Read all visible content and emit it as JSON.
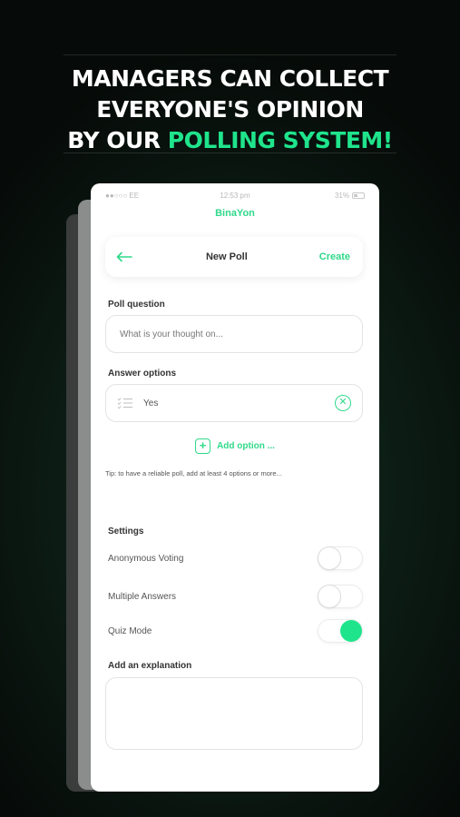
{
  "headline": {
    "line1": "MANAGERS CAN COLLECT",
    "line2": "EVERYONE'S OPINION",
    "line3_prefix": "BY OUR ",
    "line3_accent": "POLLING SYSTEM!"
  },
  "status_bar": {
    "carrier": "●●○○○ EE",
    "time": "12:53 pm",
    "battery": "31%"
  },
  "app": {
    "name": "BinaYon"
  },
  "navbar": {
    "title": "New Poll",
    "action": "Create"
  },
  "poll": {
    "question_label": "Poll question",
    "question_placeholder": "What is your thought on...",
    "options_label": "Answer options",
    "options": [
      {
        "text": "Yes"
      }
    ],
    "add_option_label": "Add option ...",
    "tip": "Tip: to have a reliable poll, add at least 4 options or more..."
  },
  "settings": {
    "heading": "Settings",
    "items": [
      {
        "label": "Anonymous Voting",
        "enabled": false
      },
      {
        "label": "Multiple Answers",
        "enabled": false
      },
      {
        "label": "Quiz Mode",
        "enabled": true
      }
    ]
  },
  "explanation": {
    "label": "Add an explanation",
    "value": ""
  },
  "colors": {
    "accent": "#2fd98a",
    "headline_accent": "#1fe48c"
  }
}
